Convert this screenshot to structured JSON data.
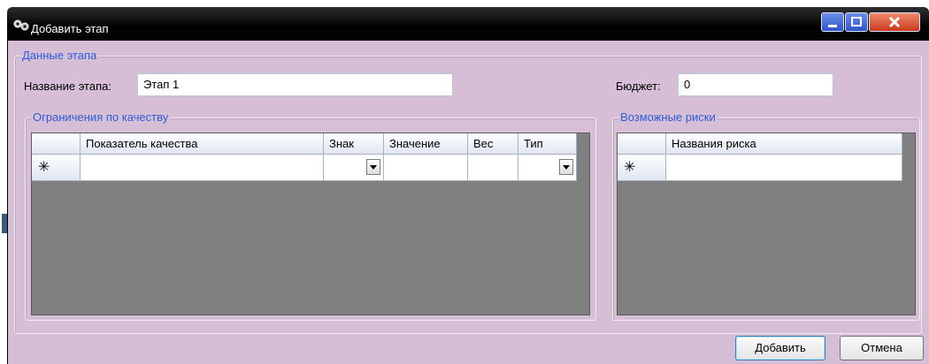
{
  "window": {
    "title": "Добавить этап",
    "controls": {
      "minimize": "minimize",
      "maximize": "maximize",
      "close": "close"
    }
  },
  "stage_group": {
    "legend": "Данные этапа",
    "name_label": "Название этапа:",
    "name_value": "Этап 1",
    "budget_label": "Бюджет:",
    "budget_value": "0"
  },
  "quality_group": {
    "legend": "Ограничения по качеству",
    "columns": [
      "Показатель качества",
      "Знак",
      "Значение",
      "Вес",
      "Тип"
    ],
    "new_row_marker": "✳"
  },
  "risk_group": {
    "legend": "Возможные риски",
    "columns": [
      "Названия риска"
    ],
    "new_row_marker": "✳"
  },
  "buttons": {
    "add": "Добавить",
    "cancel": "Отмена"
  },
  "colors": {
    "client_bg": "#d6bfd6",
    "legend_text": "#2f5bd6",
    "grid_bg": "#808080",
    "titlebar": "#000000"
  }
}
